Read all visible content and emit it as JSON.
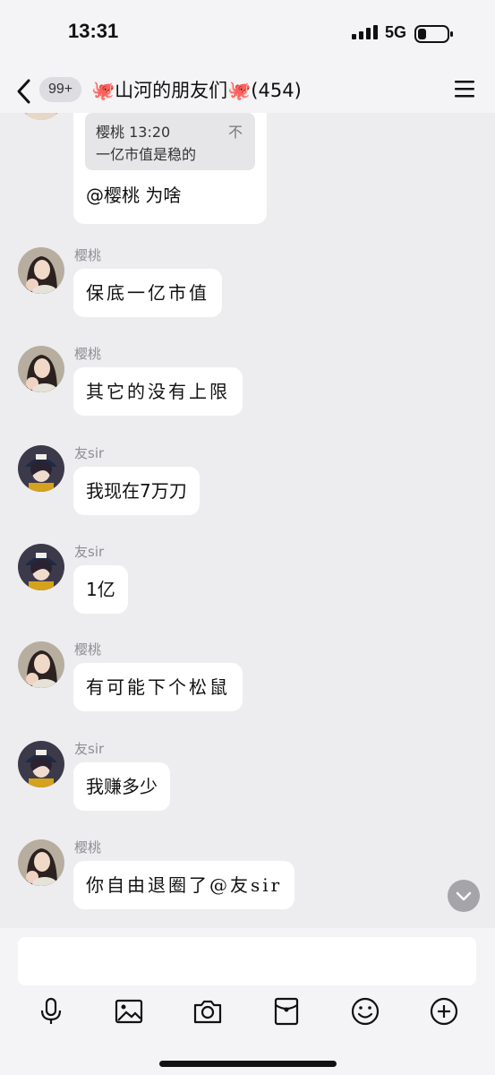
{
  "status_bar": {
    "time": "13:31",
    "network": "5G"
  },
  "nav": {
    "unread_badge": "99+",
    "group_title": "🐙山河的朋友们🐙(454)"
  },
  "quoted_message": {
    "quote_sender_time": "樱桃 13:20",
    "quote_close": "不",
    "quote_text": "一亿市值是稳的",
    "reply_text": "@樱桃 为啥"
  },
  "messages": [
    {
      "sender": "樱桃",
      "text": "保底一亿市值",
      "avatar": "girl"
    },
    {
      "sender": "樱桃",
      "text": "其它的没有上限",
      "avatar": "girl"
    },
    {
      "sender": "友sir",
      "text": "我现在7万刀",
      "avatar": "anime"
    },
    {
      "sender": "友sir",
      "text": "1亿",
      "avatar": "anime"
    },
    {
      "sender": "樱桃",
      "text": "有可能下个松鼠",
      "avatar": "girl"
    },
    {
      "sender": "友sir",
      "text": "我赚多少",
      "avatar": "anime"
    },
    {
      "sender": "樱桃",
      "text": "你自由退圈了@友sir",
      "avatar": "girl"
    }
  ],
  "input": {
    "value": "",
    "placeholder": ""
  },
  "toolbar": {
    "icons": [
      "microphone-icon",
      "image-icon",
      "camera-icon",
      "red-packet-icon",
      "emoji-icon",
      "plus-icon"
    ]
  },
  "colors": {
    "background": "#ededf0",
    "bubble": "#ffffff",
    "sender_name": "#8e8e93",
    "badge": "#dcdce1"
  }
}
